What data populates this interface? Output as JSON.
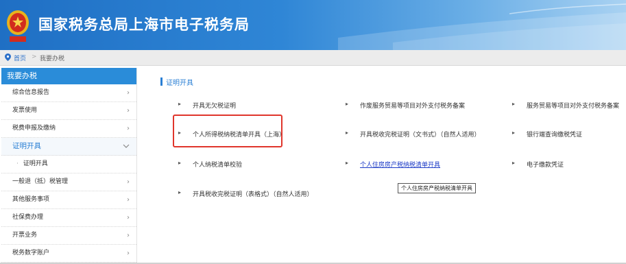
{
  "header": {
    "title": "国家税务总局上海市电子税务局"
  },
  "breadcrumb": {
    "home": "首页",
    "separator": ">",
    "current": "我要办税"
  },
  "sidebar": {
    "heading": "我要办税",
    "items": [
      {
        "label": "综合信息报告"
      },
      {
        "label": "发票使用"
      },
      {
        "label": "税费申报及缴纳"
      },
      {
        "label": "证明开具"
      },
      {
        "label": "证明开具"
      },
      {
        "label": "一般退（抵）税管理"
      },
      {
        "label": "其他服务事项"
      },
      {
        "label": "社保费办理"
      },
      {
        "label": "开票业务"
      },
      {
        "label": "税务数字账户"
      }
    ]
  },
  "main": {
    "section_title": "证明开具",
    "links": [
      {
        "label": "开具无欠税证明"
      },
      {
        "label": "作废服务贸易等项目对外支付税务备案"
      },
      {
        "label": "服务贸易等项目对外支付税务备案"
      },
      {
        "label": "个人所得税纳税清单开具（上海）"
      },
      {
        "label": "开具税收完税证明（文书式）（自然人适用）"
      },
      {
        "label": "银行端查询缴税凭证"
      },
      {
        "label": "个人纳税清单校验"
      },
      {
        "label": "个人住房房产税纳税清单开具"
      },
      {
        "label": "电子缴款凭证"
      },
      {
        "label": "开具税收完税证明（表格式）（自然人适用）"
      }
    ],
    "tooltip": "个人住房房产税纳税清单开具"
  },
  "colors": {
    "header_blue": "#1f6fc4",
    "sidebar_head": "#2a8cd9",
    "link_blue": "#1a39c6",
    "highlight_red": "#e0352b"
  }
}
